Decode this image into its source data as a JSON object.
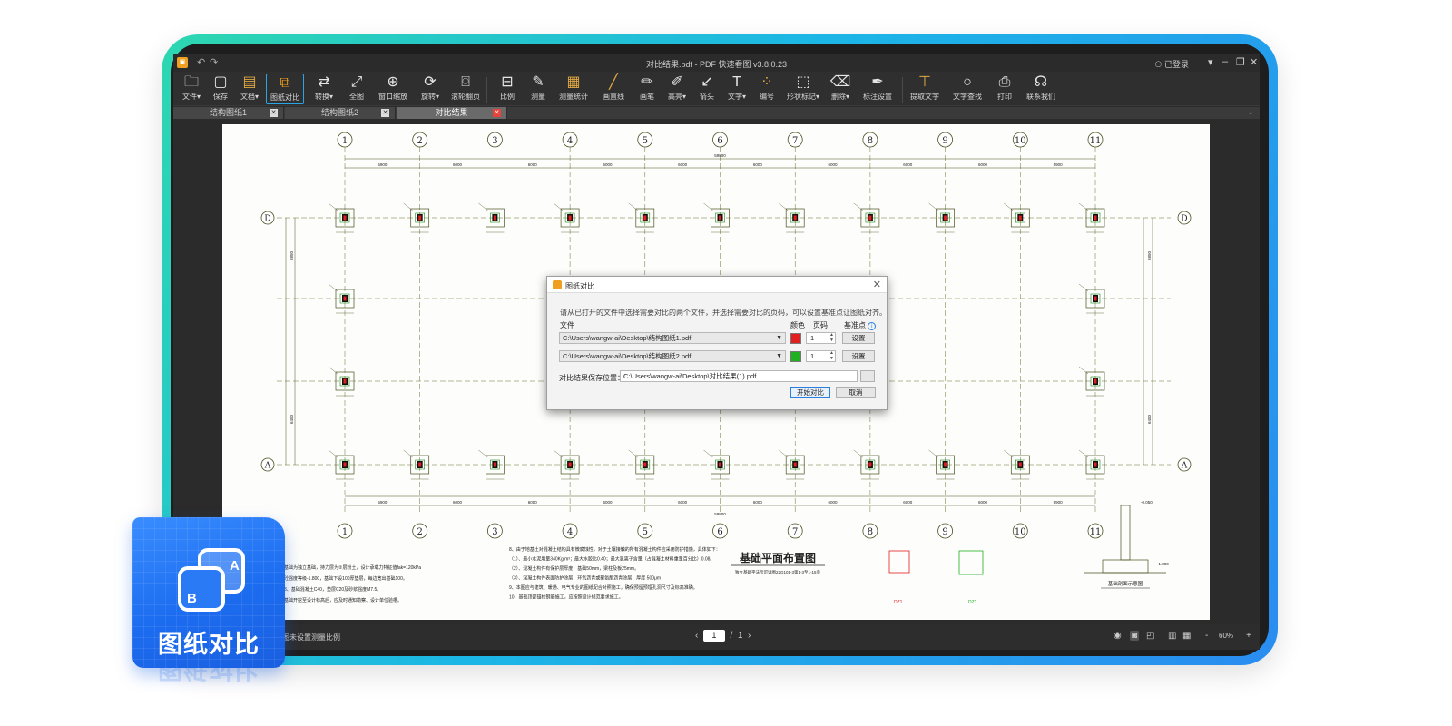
{
  "window": {
    "title": "对比结果.pdf - PDF 快速看图 v3.8.0.23",
    "user_label": "已登录"
  },
  "toolbar": {
    "items": [
      {
        "label": "文件▾",
        "icon": "folder-icon"
      },
      {
        "label": "保存",
        "icon": "save-icon"
      },
      {
        "label": "文档▾",
        "icon": "document-icon"
      },
      {
        "label": "图纸对比",
        "icon": "compare-icon"
      },
      {
        "label": "转换▾",
        "icon": "convert-icon"
      },
      {
        "label": "全图",
        "icon": "fit-all-icon"
      },
      {
        "label": "窗口缩放",
        "icon": "zoom-window-icon"
      },
      {
        "label": "旋转▾",
        "icon": "rotate-icon"
      },
      {
        "label": "滚轮翻页",
        "icon": "mouse-wheel-icon"
      },
      {
        "label": "比例",
        "icon": "scale-icon"
      },
      {
        "label": "测量",
        "icon": "measure-icon"
      },
      {
        "label": "测量统计",
        "icon": "measure-stats-icon"
      },
      {
        "label": "画直线",
        "icon": "line-icon"
      },
      {
        "label": "画笔",
        "icon": "pen-icon"
      },
      {
        "label": "高亮▾",
        "icon": "highlight-icon"
      },
      {
        "label": "箭头",
        "icon": "arrow-icon"
      },
      {
        "label": "文字▾",
        "icon": "text-icon"
      },
      {
        "label": "编号",
        "icon": "numbering-icon"
      },
      {
        "label": "形状标记▾",
        "icon": "shape-mark-icon"
      },
      {
        "label": "删除▾",
        "icon": "eraser-icon"
      },
      {
        "label": "标注设置",
        "icon": "annotation-settings-icon"
      },
      {
        "label": "提取文字",
        "icon": "extract-text-icon"
      },
      {
        "label": "文字查找",
        "icon": "find-text-icon"
      },
      {
        "label": "打印",
        "icon": "print-icon"
      },
      {
        "label": "联系我们",
        "icon": "headset-icon"
      }
    ]
  },
  "tabs": [
    {
      "label": "结构图纸1"
    },
    {
      "label": "结构图纸2"
    },
    {
      "label": "对比结果"
    }
  ],
  "drawing": {
    "title": "基础平面布置图",
    "subtitle": "独立基础平法示可详图22G101-3第1-3至1-15页",
    "detail_title": "基础剖面示意图",
    "grid_numbers": [
      "1",
      "2",
      "3",
      "4",
      "5",
      "6",
      "7",
      "8",
      "9",
      "10",
      "11"
    ],
    "grid_letters_top": "D",
    "grid_letters_bottom": "A",
    "dims_top": [
      "5900",
      "6000",
      "6000",
      "6000",
      "6000",
      "6000",
      "6000",
      "6000",
      "6000",
      "5900"
    ],
    "total_dim": "59800",
    "side_dims": [
      "6850",
      "6450"
    ],
    "notes": [
      "8、由于地基土对混凝土结构具有微腐蚀性，对于土壤接触的所有混凝土构件应采用防护措施，具体如下：",
      "（1）、最小水泥用量340Kg/m³；最大水胶比0.40；最大氯离子含量（占混凝土材料重量百分比）0.08。",
      "（2）、混凝土构件有保护层厚度：基础50mm，梁柱及板25mm。",
      "（3）、混凝土构件表面防护涂层，环氧沥青或聚氨酯沥青涂层，厚度 500μm",
      "9、本图应与建筑、暖通、电气专业的图纸配合对照施工，确保预留预埋孔洞尺寸及标高准确。",
      "10、基础顶部锚栓钢筋施工，应按照设计规范要求施工。"
    ],
    "left_notes": [
      "基础为独立基础，持力层为②层粉土，设计承载力特征值fak=120kPa",
      "砼强度等级-1.800，基础下设100厚垫层，每边宽出基础100。",
      "3、基础混凝土C40，垫层C20及砂浆强度M7.5。",
      "基础开挖至设计标高后，应及时通知勘察、设计单位验槽。"
    ],
    "detail_labels": [
      "DZ1",
      "DZ1",
      "-0.050",
      "-1.800"
    ]
  },
  "dialog": {
    "title": "图纸对比",
    "description": "请从已打开的文件中选择需要对比的两个文件，并选择需要对比的页码，可以设置基准点让图纸对齐。",
    "col_file": "文件",
    "col_color": "颜色",
    "col_page": "页码",
    "col_base": "基准点",
    "info_glyph": "i",
    "rows": [
      {
        "file": "C:\\Users\\wangw-ai\\Desktop\\结构图纸1.pdf",
        "color": "#e02020",
        "page": "1",
        "btn": "设置"
      },
      {
        "file": "C:\\Users\\wangw-ai\\Desktop\\结构图纸2.pdf",
        "color": "#20b020",
        "page": "1",
        "btn": "设置"
      }
    ],
    "save_label": "对比结果保存位置：",
    "save_path": "C:\\Users\\wangw-ai\\Desktop\\对比结果(1).pdf",
    "browse_label": "...",
    "start_button": "开始对比",
    "cancel_button": "取消"
  },
  "statusbar": {
    "hint": "图未设置测量比例",
    "page_current": "1",
    "page_sep": "/",
    "page_total": "1",
    "zoom": "60%"
  },
  "badge": {
    "label": "图纸对比",
    "glyph_a": "A",
    "glyph_b": "B"
  }
}
